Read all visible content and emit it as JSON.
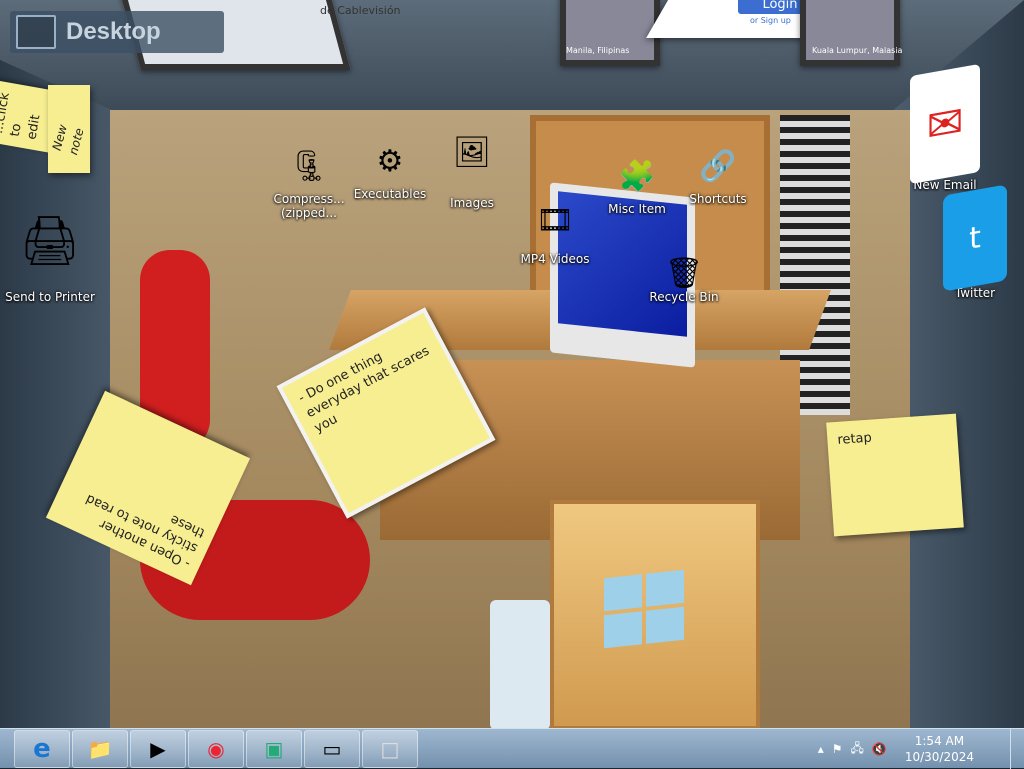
{
  "desktop_badge": {
    "label": "Desktop"
  },
  "ceiling_texts": {
    "cablevision": "de Cablevisión",
    "login": "Login",
    "signup": "or Sign up",
    "manila": "Manila, Filipinas",
    "kuala": "Kuala Lumpur, Malasia"
  },
  "icons": [
    {
      "id": "compress",
      "label": "Compress... (zipped...",
      "icon": "zip-icon"
    },
    {
      "id": "executables",
      "label": "Executables",
      "icon": "executables-icon"
    },
    {
      "id": "images",
      "label": "Images",
      "icon": "images-icon"
    },
    {
      "id": "misc",
      "label": "Misc Item",
      "icon": "misc-icon"
    },
    {
      "id": "shortcuts",
      "label": "Shortcuts",
      "icon": "shortcuts-icon"
    },
    {
      "id": "mp4",
      "label": "MP4 Videos",
      "icon": "video-icon"
    },
    {
      "id": "recycle",
      "label": "Recycle Bin",
      "icon": "recycle-bin-icon"
    },
    {
      "id": "new-email",
      "label": "New Email",
      "icon": "email-icon"
    },
    {
      "id": "twitter",
      "label": "Twitter",
      "icon": "twitter-icon"
    },
    {
      "id": "send-printer",
      "label": "Send to Printer",
      "icon": "printer-icon"
    }
  ],
  "stickies": {
    "top_left_a": "...click to edit",
    "top_left_b": "New note",
    "center": "- Do one thing everyday that scares you",
    "left": "- Open another sticky note to read these",
    "right": "retap"
  },
  "taskbar": {
    "buttons": [
      {
        "name": "ie-icon",
        "glyph": "e"
      },
      {
        "name": "file-explorer-icon",
        "glyph": "📁"
      },
      {
        "name": "media-player-icon",
        "glyph": "▶"
      },
      {
        "name": "colorful-app-icon",
        "glyph": "◉"
      },
      {
        "name": "app-window-icon",
        "glyph": "▣"
      },
      {
        "name": "display-settings-icon",
        "glyph": "▭"
      },
      {
        "name": "generic-window-icon",
        "glyph": "□"
      }
    ],
    "time": "1:54 AM",
    "date": "10/30/2024"
  }
}
